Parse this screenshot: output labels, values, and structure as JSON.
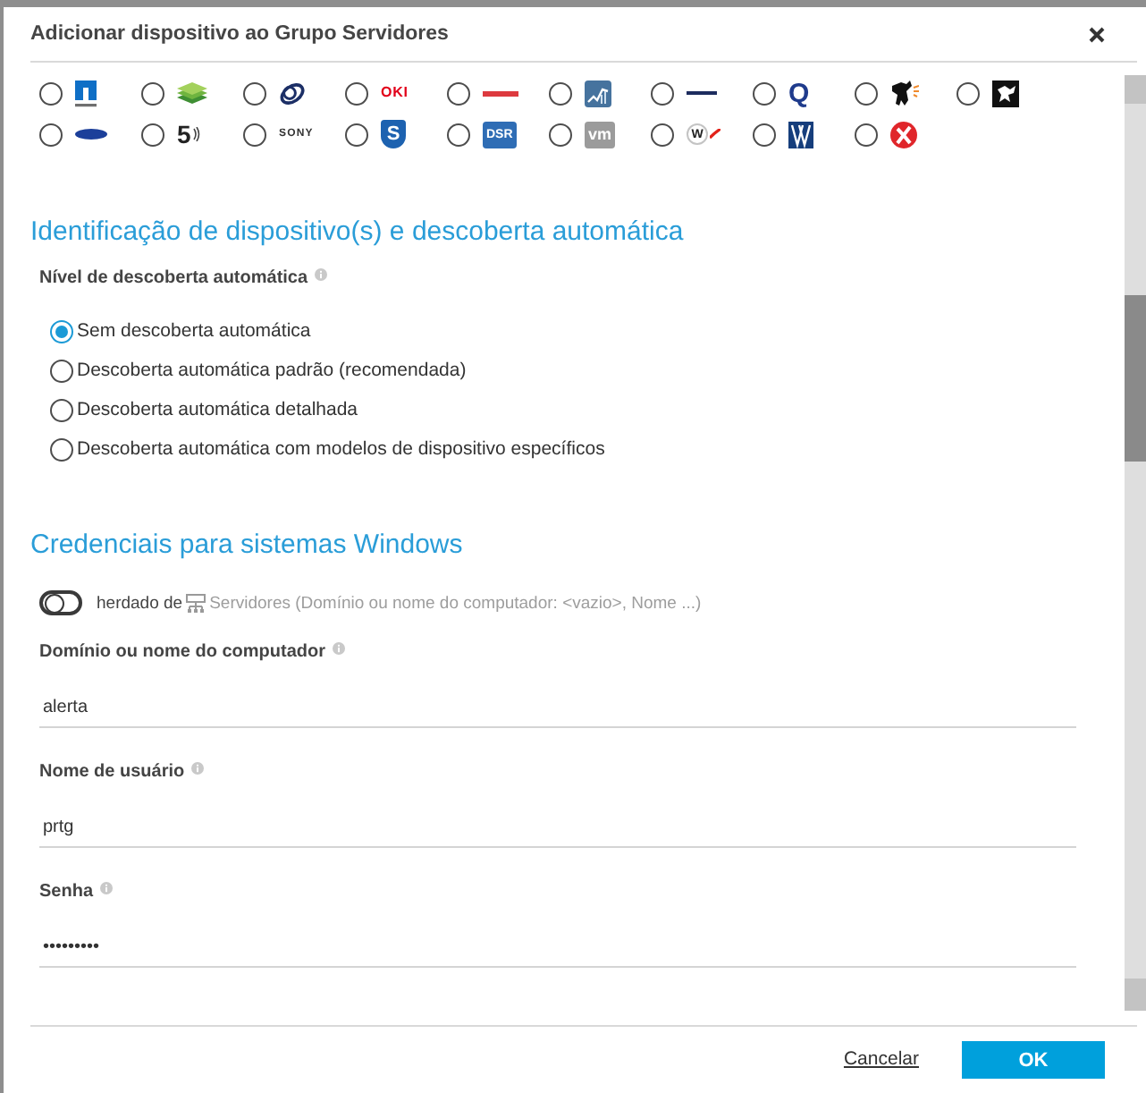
{
  "dialog": {
    "title": "Adicionar dispositivo ao Grupo Servidores"
  },
  "vendor_options": [
    {
      "kind": "blue-square",
      "selected": false
    },
    {
      "kind": "green-layers",
      "selected": false
    },
    {
      "kind": "navy-ring",
      "selected": false
    },
    {
      "kind": "red-wordmark",
      "label": "OKI",
      "selected": false
    },
    {
      "kind": "red-line",
      "selected": false
    },
    {
      "kind": "chart-tile",
      "selected": false
    },
    {
      "kind": "navy-line",
      "selected": false
    },
    {
      "kind": "navy-letter",
      "label": "Q",
      "selected": false
    },
    {
      "kind": "black-figure",
      "selected": false
    },
    {
      "kind": "black-tile",
      "selected": false
    },
    {
      "kind": "blue-oval",
      "selected": false
    },
    {
      "kind": "dark-numeral",
      "label": "5",
      "selected": false
    },
    {
      "kind": "dark-wordmark",
      "label": "SONY",
      "selected": false
    },
    {
      "kind": "blue-shield",
      "label": "S",
      "selected": false
    },
    {
      "kind": "blue-tile-text",
      "label": "DSR",
      "selected": false
    },
    {
      "kind": "grey-tile-text",
      "label": "vm",
      "selected": false
    },
    {
      "kind": "circle-letter",
      "label": "W",
      "selected": false
    },
    {
      "kind": "blue-lines-tile",
      "selected": false
    },
    {
      "kind": "red-circle-cross",
      "selected": false
    }
  ],
  "discovery": {
    "heading": "Identificação de dispositivo(s) e descoberta automática",
    "label": "Nível de descoberta automática",
    "options": [
      {
        "label": "Sem descoberta automática",
        "selected": true
      },
      {
        "label": "Descoberta automática padrão (recomendada)",
        "selected": false
      },
      {
        "label": "Descoberta automática detalhada",
        "selected": false
      },
      {
        "label": "Descoberta automática com modelos de dispositivo específicos",
        "selected": false
      }
    ]
  },
  "credentials": {
    "heading": "Credenciais para sistemas Windows",
    "inherit": {
      "on": false,
      "prefix": "herdado de",
      "source": "Servidores (Domínio ou nome do computador: <vazio>, Nome ...)"
    },
    "fields": [
      {
        "label": "Domínio ou nome do computador",
        "value": "alerta"
      },
      {
        "label": "Nome de usuário",
        "value": "prtg"
      },
      {
        "label": "Senha",
        "value": "•••••••••"
      }
    ]
  },
  "footer": {
    "buttons": [
      {
        "kind": "link",
        "label": "Cancelar"
      },
      {
        "kind": "primary",
        "label": "OK"
      }
    ]
  }
}
